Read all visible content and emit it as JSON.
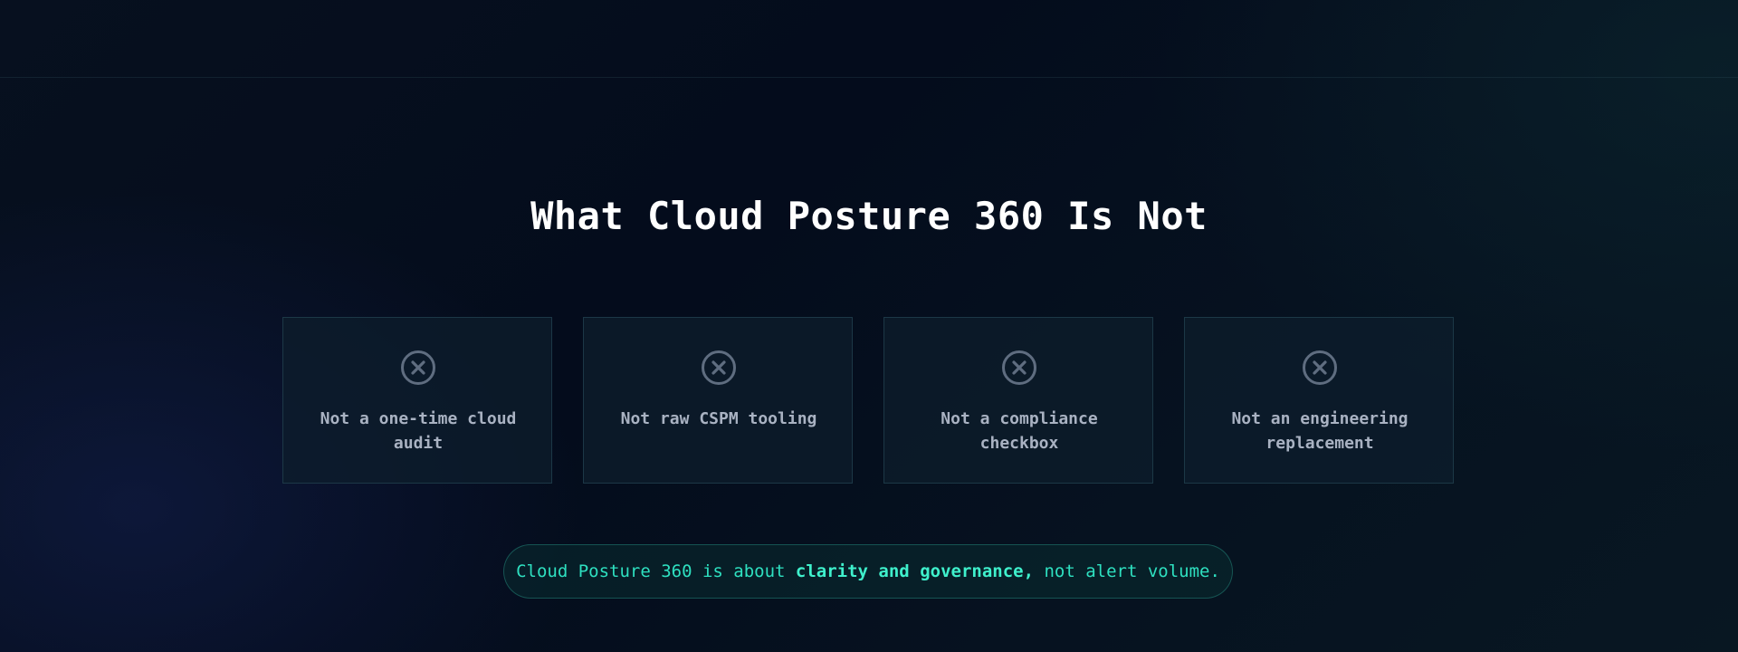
{
  "section": {
    "title": "What Cloud Posture 360 Is Not",
    "cards": [
      {
        "icon": "x-circle-icon",
        "text": "Not a one-time cloud audit"
      },
      {
        "icon": "x-circle-icon",
        "text": "Not raw CSPM tooling"
      },
      {
        "icon": "x-circle-icon",
        "text": "Not a compliance checkbox"
      },
      {
        "icon": "x-circle-icon",
        "text": "Not an engineering replacement"
      }
    ],
    "note": {
      "before": "Cloud Posture 360 is about ",
      "emphasis": "clarity and governance,",
      "after": " not alert volume."
    }
  },
  "colors": {
    "background": "#050d1c",
    "card_background": "#0d1e2c",
    "card_border": "#264856",
    "card_text": "#a9b2c2",
    "icon": "#5f6d80",
    "accent": "#2ee0c0"
  }
}
